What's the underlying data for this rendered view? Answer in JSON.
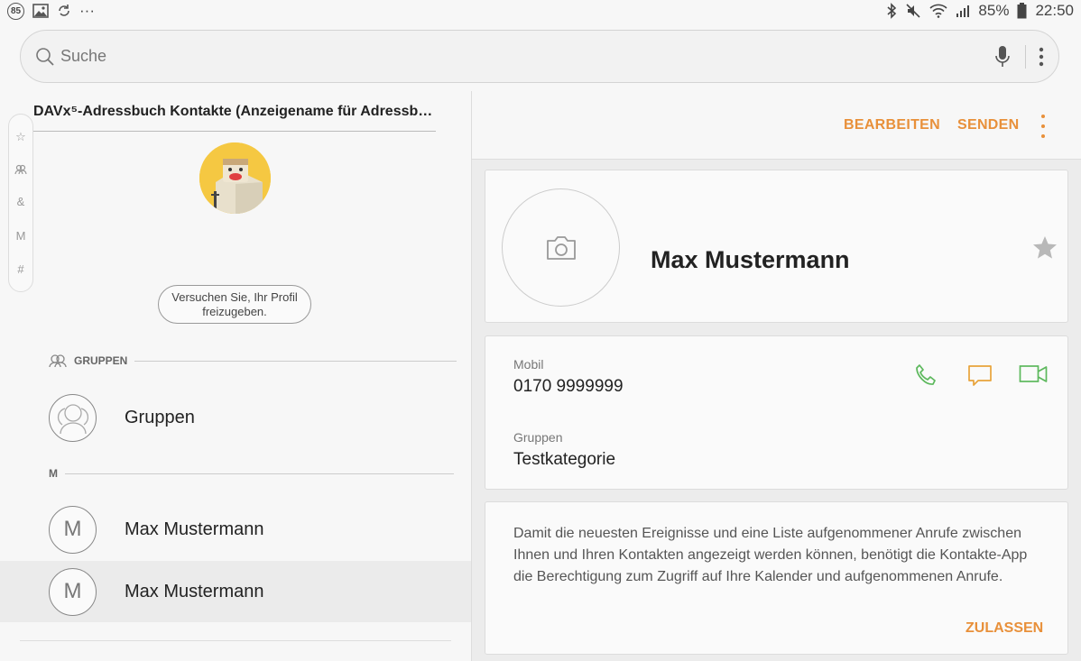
{
  "status_bar": {
    "badge": "85",
    "more": "···",
    "battery": "85%",
    "time": "22:50"
  },
  "search": {
    "placeholder": "Suche"
  },
  "left": {
    "account_title": "DAVx⁵-Adressbuch Kontakte (Anzeigename für Adressbuch)",
    "index": [
      "☆",
      "&",
      "M",
      "#"
    ],
    "profile_button": "Versuchen Sie, Ihr Profil freizugeben.",
    "section_groups": "GRUPPEN",
    "groups_row": "Gruppen",
    "section_m": "M",
    "contacts": [
      {
        "initial": "M",
        "name": "Max Mustermann"
      },
      {
        "initial": "M",
        "name": "Max Mustermann"
      }
    ]
  },
  "right": {
    "toolbar": {
      "edit": "BEARBEITEN",
      "send": "SENDEN"
    },
    "contact_name": "Max Mustermann",
    "phone": {
      "label": "Mobil",
      "value": "0170 9999999"
    },
    "groups": {
      "label": "Gruppen",
      "value": "Testkategorie"
    },
    "permission": {
      "text": "Damit die neuesten Ereignisse und eine Liste aufgenommener Anrufe zwischen Ihnen und Ihren Kontakten angezeigt werden können, benötigt die Kontakte-App die Berechtigung zum Zugriff auf Ihre Kalender und aufgenommenen Anrufe.",
      "button": "ZULASSEN"
    }
  },
  "colors": {
    "accent": "#e8903a",
    "call": "#5cb85c",
    "message": "#e8a33a",
    "video": "#5cb85c"
  }
}
